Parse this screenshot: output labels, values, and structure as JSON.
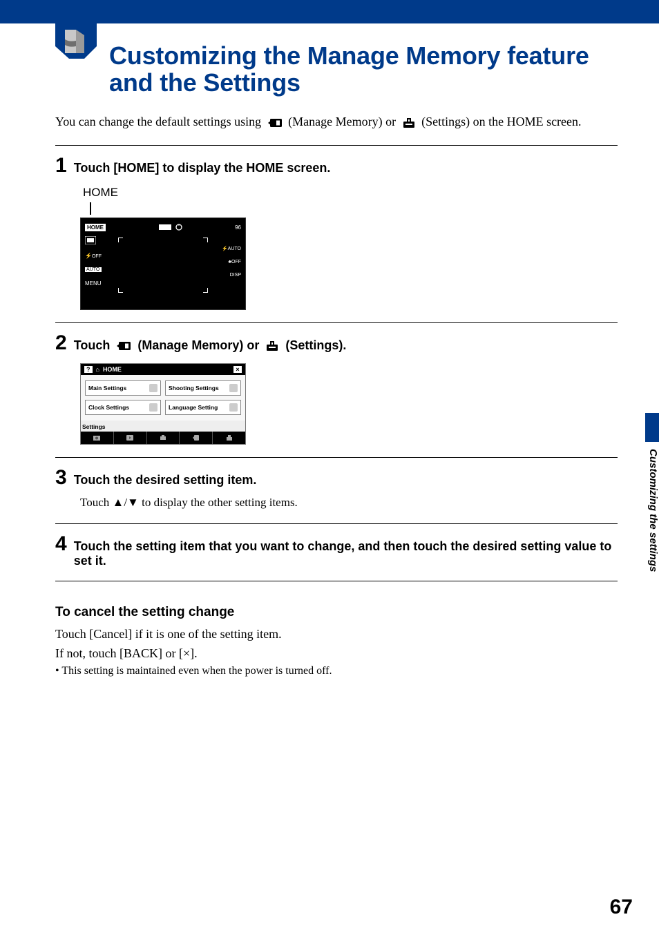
{
  "header": {
    "kicker": "Customizing the settings",
    "title": "Customizing the Manage Memory feature and the Settings"
  },
  "intro": {
    "p1a": "You can change the default settings using ",
    "p1b": " (Manage Memory) or ",
    "p1c": " (Settings) on the HOME screen."
  },
  "steps": {
    "s1": {
      "num": "1",
      "text": "Touch [HOME] to display the HOME screen."
    },
    "s2": {
      "num": "2",
      "a": "Touch ",
      "b": " (Manage Memory) or ",
      "c": " (Settings)."
    },
    "s3": {
      "num": "3",
      "text": "Touch the desired setting item.",
      "sub": "Touch ▲/▼ to display the other setting items."
    },
    "s4": {
      "num": "4",
      "text": "Touch the setting item that you want to change, and then touch the desired setting value to set it."
    }
  },
  "fig1": {
    "label": "HOME",
    "overlay": {
      "home": "HOME",
      "count": "96",
      "menu": "MENU",
      "off": "OFF",
      "auto": "AUTO",
      "disp": "DISP"
    }
  },
  "fig2": {
    "bar_home": "HOME",
    "btns": {
      "main": "Main Settings",
      "shoot": "Shooting Settings",
      "clock": "Clock Settings",
      "lang": "Language Setting"
    },
    "label": "Settings"
  },
  "cancel": {
    "h": "To cancel the setting change",
    "p1": "Touch [Cancel] if it is one of the setting item.",
    "p2": "If not, touch [BACK] or [×].",
    "bul": "• This setting is maintained even when the power is turned off."
  },
  "side_label": "Customizing the settings",
  "page_number": "67"
}
